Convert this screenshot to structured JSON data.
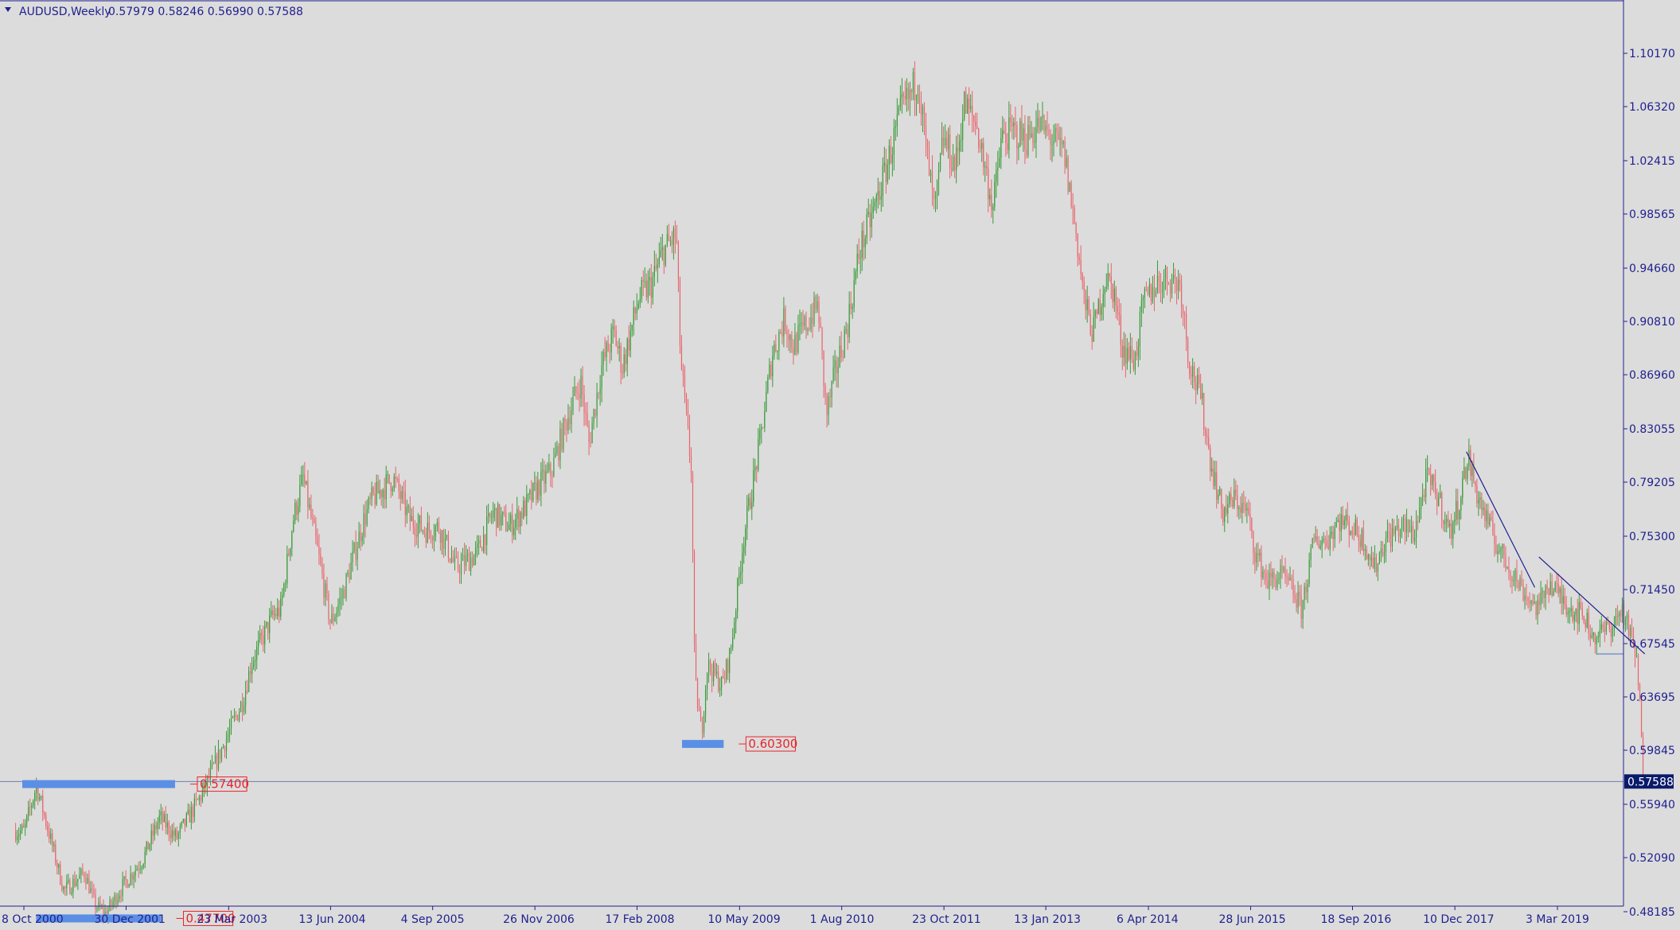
{
  "header": {
    "symbol": "AUDUSD,Weekly",
    "ohlc": "0.57979 0.58246 0.56990 0.57588"
  },
  "current_price": "0.57588",
  "colors": {
    "background": "#dcdcdc",
    "bull": "#3a9a3a",
    "bear": "#e8646c",
    "zone": "#5b8fe6",
    "trendline": "#1f1f8f",
    "level_label": "#e8242b",
    "axis_text": "#1f1f8f"
  },
  "chart_data": {
    "type": "candlestick",
    "symbol": "AUDUSD",
    "timeframe": "Weekly",
    "y_ticks": [
      "1.10170",
      "1.06320",
      "1.02415",
      "0.98565",
      "0.94660",
      "0.90810",
      "0.86960",
      "0.83055",
      "0.79205",
      "0.75300",
      "0.71450",
      "0.67545",
      "0.63695",
      "0.59845",
      "0.55940",
      "0.52090",
      "0.48185"
    ],
    "x_ticks": [
      "8 Oct 2000",
      "30 Dec 2001",
      "23 Mar 2003",
      "13 Jun 2004",
      "4 Sep 2005",
      "26 Nov 2006",
      "17 Feb 2008",
      "10 May 2009",
      "1 Aug 2010",
      "23 Oct 2011",
      "13 Jan 2013",
      "6 Apr 2014",
      "28 Jun 2015",
      "18 Sep 2016",
      "10 Dec 2017",
      "3 Mar 2019"
    ],
    "ylim": [
      0.4705,
      1.1395
    ],
    "price_path": [
      [
        2000.77,
        0.54
      ],
      [
        2000.92,
        0.573
      ],
      [
        2001.25,
        0.497
      ],
      [
        2001.5,
        0.51
      ],
      [
        2001.62,
        0.487
      ],
      [
        2001.75,
        0.48
      ],
      [
        2001.95,
        0.5
      ],
      [
        2002.2,
        0.52
      ],
      [
        2002.4,
        0.55
      ],
      [
        2002.6,
        0.535
      ],
      [
        2002.9,
        0.566
      ],
      [
        2003.15,
        0.6
      ],
      [
        2003.4,
        0.635
      ],
      [
        2003.5,
        0.662
      ],
      [
        2003.75,
        0.695
      ],
      [
        2003.85,
        0.7
      ],
      [
        2004.0,
        0.765
      ],
      [
        2004.12,
        0.795
      ],
      [
        2004.3,
        0.74
      ],
      [
        2004.45,
        0.69
      ],
      [
        2004.6,
        0.712
      ],
      [
        2004.85,
        0.765
      ],
      [
        2004.95,
        0.78
      ],
      [
        2005.2,
        0.795
      ],
      [
        2005.4,
        0.765
      ],
      [
        2005.6,
        0.757
      ],
      [
        2005.75,
        0.76
      ],
      [
        2005.95,
        0.73
      ],
      [
        2006.2,
        0.74
      ],
      [
        2006.4,
        0.77
      ],
      [
        2006.6,
        0.76
      ],
      [
        2006.8,
        0.775
      ],
      [
        2006.95,
        0.79
      ],
      [
        2007.1,
        0.8
      ],
      [
        2007.3,
        0.84
      ],
      [
        2007.45,
        0.865
      ],
      [
        2007.55,
        0.82
      ],
      [
        2007.7,
        0.875
      ],
      [
        2007.85,
        0.9
      ],
      [
        2007.95,
        0.875
      ],
      [
        2008.15,
        0.925
      ],
      [
        2008.3,
        0.935
      ],
      [
        2008.45,
        0.96
      ],
      [
        2008.6,
        0.97
      ],
      [
        2008.65,
        0.88
      ],
      [
        2008.78,
        0.8
      ],
      [
        2008.82,
        0.65
      ],
      [
        2008.9,
        0.61
      ],
      [
        2008.97,
        0.66
      ],
      [
        2009.15,
        0.645
      ],
      [
        2009.25,
        0.67
      ],
      [
        2009.4,
        0.75
      ],
      [
        2009.6,
        0.82
      ],
      [
        2009.75,
        0.885
      ],
      [
        2009.9,
        0.91
      ],
      [
        2010.0,
        0.89
      ],
      [
        2010.15,
        0.905
      ],
      [
        2010.3,
        0.92
      ],
      [
        2010.4,
        0.84
      ],
      [
        2010.5,
        0.87
      ],
      [
        2010.65,
        0.905
      ],
      [
        2010.8,
        0.96
      ],
      [
        2010.95,
        0.985
      ],
      [
        2011.1,
        1.015
      ],
      [
        2011.3,
        1.06
      ],
      [
        2011.4,
        1.07
      ],
      [
        2011.5,
        1.085
      ],
      [
        2011.6,
        1.03
      ],
      [
        2011.7,
        0.985
      ],
      [
        2011.8,
        1.04
      ],
      [
        2011.95,
        1.02
      ],
      [
        2012.05,
        1.065
      ],
      [
        2012.2,
        1.05
      ],
      [
        2012.4,
        0.99
      ],
      [
        2012.5,
        1.04
      ],
      [
        2012.65,
        1.045
      ],
      [
        2012.8,
        1.04
      ],
      [
        2012.95,
        1.05
      ],
      [
        2013.1,
        1.04
      ],
      [
        2013.25,
        1.03
      ],
      [
        2013.4,
        0.97
      ],
      [
        2013.5,
        0.92
      ],
      [
        2013.6,
        0.9
      ],
      [
        2013.75,
        0.94
      ],
      [
        2013.85,
        0.93
      ],
      [
        2013.95,
        0.89
      ],
      [
        2014.1,
        0.88
      ],
      [
        2014.2,
        0.92
      ],
      [
        2014.35,
        0.935
      ],
      [
        2014.5,
        0.94
      ],
      [
        2014.65,
        0.935
      ],
      [
        2014.75,
        0.88
      ],
      [
        2014.9,
        0.85
      ],
      [
        2015.0,
        0.81
      ],
      [
        2015.15,
        0.77
      ],
      [
        2015.3,
        0.78
      ],
      [
        2015.45,
        0.77
      ],
      [
        2015.55,
        0.74
      ],
      [
        2015.7,
        0.72
      ],
      [
        2015.85,
        0.725
      ],
      [
        2015.98,
        0.715
      ],
      [
        2016.1,
        0.7
      ],
      [
        2016.25,
        0.75
      ],
      [
        2016.4,
        0.75
      ],
      [
        2016.55,
        0.765
      ],
      [
        2016.7,
        0.76
      ],
      [
        2016.85,
        0.75
      ],
      [
        2016.98,
        0.73
      ],
      [
        2017.1,
        0.75
      ],
      [
        2017.3,
        0.76
      ],
      [
        2017.45,
        0.755
      ],
      [
        2017.6,
        0.795
      ],
      [
        2017.75,
        0.78
      ],
      [
        2017.88,
        0.755
      ],
      [
        2017.98,
        0.775
      ],
      [
        2018.1,
        0.81
      ],
      [
        2018.2,
        0.785
      ],
      [
        2018.35,
        0.76
      ],
      [
        2018.5,
        0.74
      ],
      [
        2018.65,
        0.725
      ],
      [
        2018.8,
        0.71
      ],
      [
        2018.95,
        0.7
      ],
      [
        2019.05,
        0.72
      ],
      [
        2019.2,
        0.71
      ],
      [
        2019.35,
        0.7
      ],
      [
        2019.5,
        0.695
      ],
      [
        2019.6,
        0.68
      ],
      [
        2019.75,
        0.685
      ],
      [
        2019.85,
        0.69
      ],
      [
        2019.95,
        0.7
      ],
      [
        2020.05,
        0.68
      ],
      [
        2020.12,
        0.665
      ],
      [
        2020.17,
        0.62
      ],
      [
        2020.2,
        0.575
      ]
    ],
    "marked_levels": [
      {
        "price": 0.574,
        "label": "0.57400",
        "zone_from": "2000-10",
        "zone_to": "2002-08"
      },
      {
        "price": 0.603,
        "label": "0.60300",
        "zone_from": "2008-09",
        "zone_to": "2009-03"
      },
      {
        "price": 0.477,
        "label": "0.47700",
        "zone_from": "2000-12",
        "zone_to": "2002-06"
      }
    ],
    "trendlines": [
      {
        "from": [
          2018.08,
          0.814
        ],
        "to": [
          2018.9,
          0.716
        ]
      },
      {
        "from": [
          2018.95,
          0.738
        ],
        "to": [
          2020.22,
          0.668
        ]
      }
    ],
    "horizontal_lines": [
      {
        "price": 0.57588
      },
      {
        "price": 0.668,
        "from": 2019.65,
        "to": 2020.22
      }
    ]
  }
}
